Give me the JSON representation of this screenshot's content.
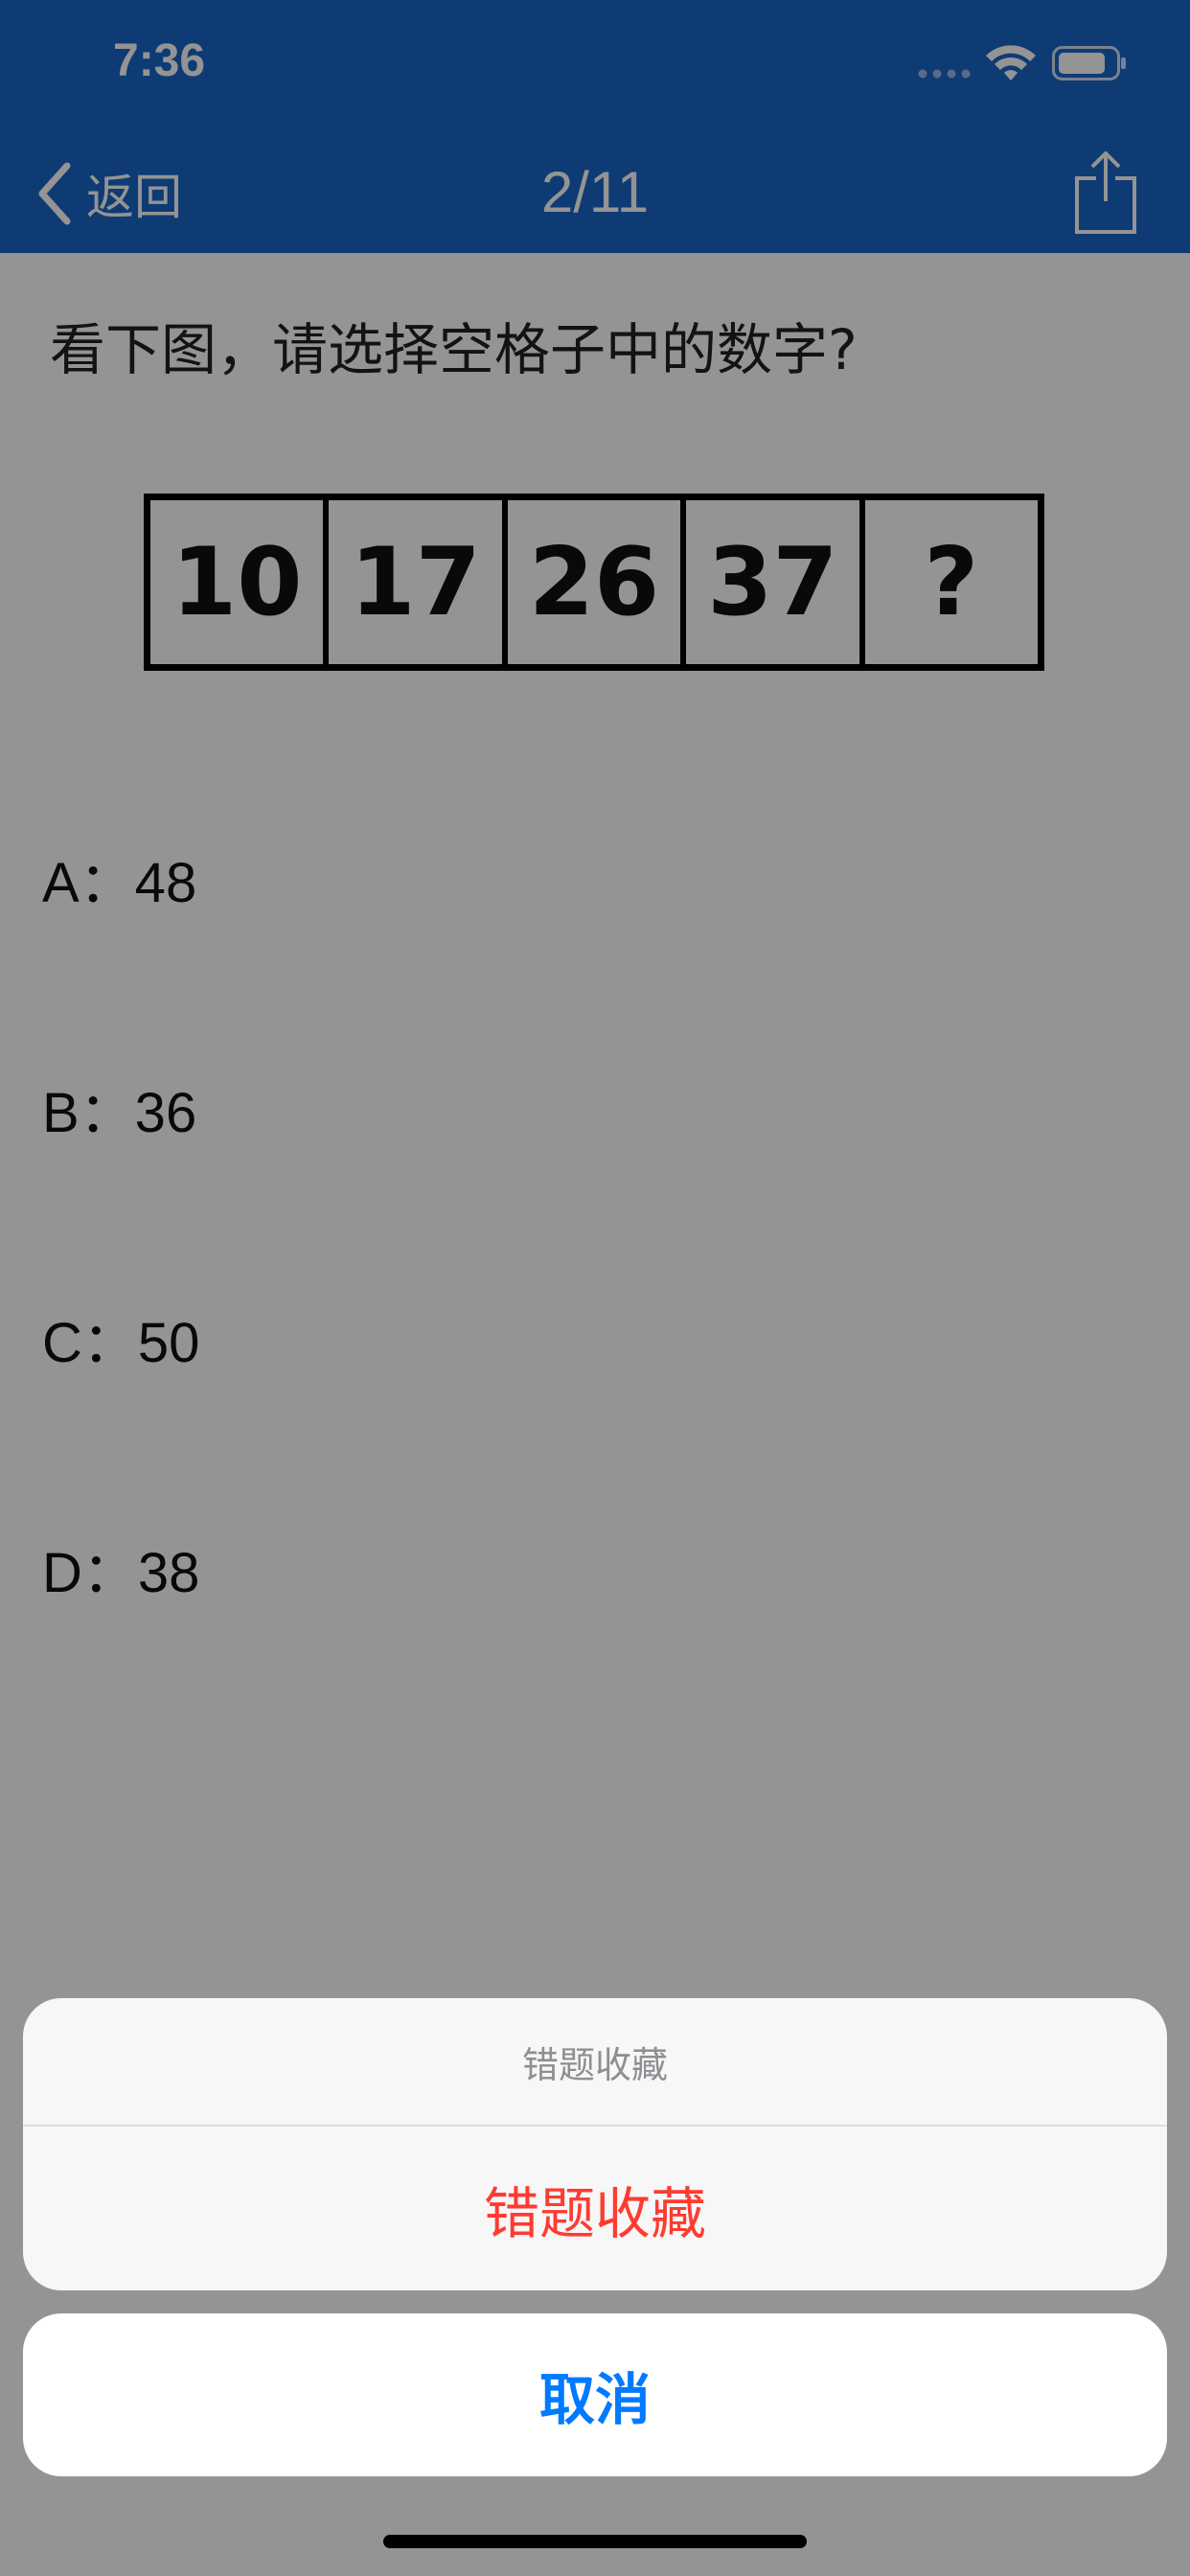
{
  "status_bar": {
    "time": "7:36",
    "icons": [
      "signal-dots-icon",
      "wifi-icon",
      "battery-icon"
    ]
  },
  "nav": {
    "back_label": "返回",
    "counter": "2/11",
    "back_icon": "chevron-left-icon",
    "share_icon": "share-icon"
  },
  "question": {
    "text": "看下图，请选择空格子中的数字?",
    "sequence": [
      "10",
      "17",
      "26",
      "37",
      "?"
    ]
  },
  "options": [
    {
      "label": "A：48"
    },
    {
      "label": "B：36"
    },
    {
      "label": "C：50"
    },
    {
      "label": "D：38"
    }
  ],
  "action_sheet": {
    "title": "错题收藏",
    "action_label": "错题收藏",
    "cancel_label": "取消"
  },
  "colors": {
    "nav_background": "#1b67c9",
    "destructive": "#ff3b30",
    "cancel": "#007aff"
  }
}
